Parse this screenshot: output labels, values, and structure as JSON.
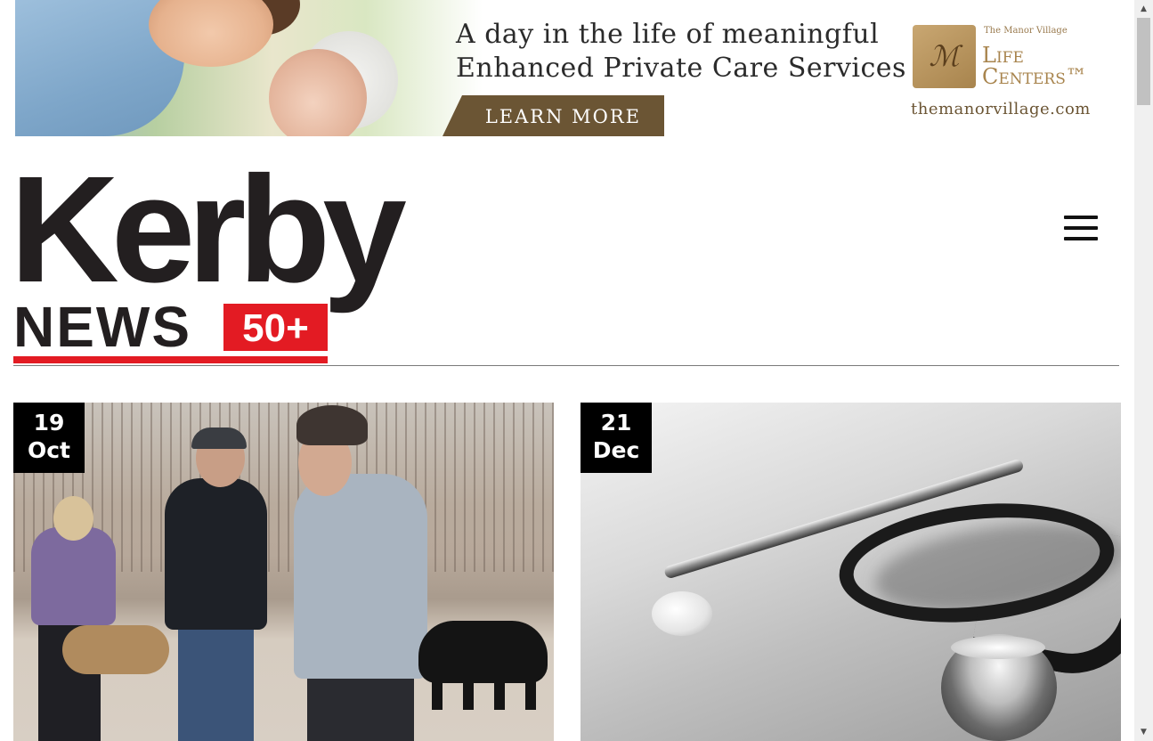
{
  "ad": {
    "headline_line1": "A day in the life of meaningful",
    "headline_line2": "Enhanced Private Care Services",
    "cta_label": "LEARN MORE",
    "brand_small": "The Manor Village",
    "brand_big_line1": "Life",
    "brand_big_line2": "Centers™",
    "logo_mark": "ℳ",
    "url": "themanorvillage.com",
    "colors": {
      "cta_bg": "#6b5534",
      "brand_gold": "#a8844d"
    }
  },
  "header": {
    "logo_word": "Kerby",
    "logo_news": "NEWS",
    "logo_badge": "50+",
    "menu_icon": "hamburger-menu-icon",
    "colors": {
      "logo_dark": "#231f20",
      "logo_red": "#e31b23"
    }
  },
  "articles": [
    {
      "day": "19",
      "month": "Oct",
      "image_desc_icon": "park-walk-photo"
    },
    {
      "day": "21",
      "month": "Dec",
      "image_desc_icon": "stethoscope-photo"
    }
  ],
  "scrollbar": {
    "up_icon": "▲",
    "down_icon": "▼"
  }
}
